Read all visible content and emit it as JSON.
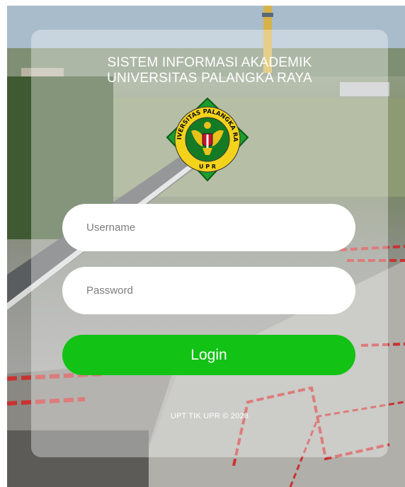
{
  "header": {
    "title_line1": "SISTEM INFORMASI AKADEMIK",
    "title_line2": "UNIVERSITAS PALANGKA RAYA"
  },
  "logo": {
    "ring_text": "UNIVERSITAS PALANGKA RAYA",
    "bottom_text": "U P R",
    "colors": {
      "outer": "#1c9e2e",
      "ring": "#f3d21c",
      "inner": "#157a24",
      "shield": "#c8102e"
    }
  },
  "form": {
    "username_placeholder": "Username",
    "password_placeholder": "Password",
    "login_label": "Login"
  },
  "footer": {
    "text": "UPT TIK UPR © 2023"
  },
  "colors": {
    "accent": "#12c214",
    "card_tint": "rgba(255,255,255,0.36)"
  }
}
